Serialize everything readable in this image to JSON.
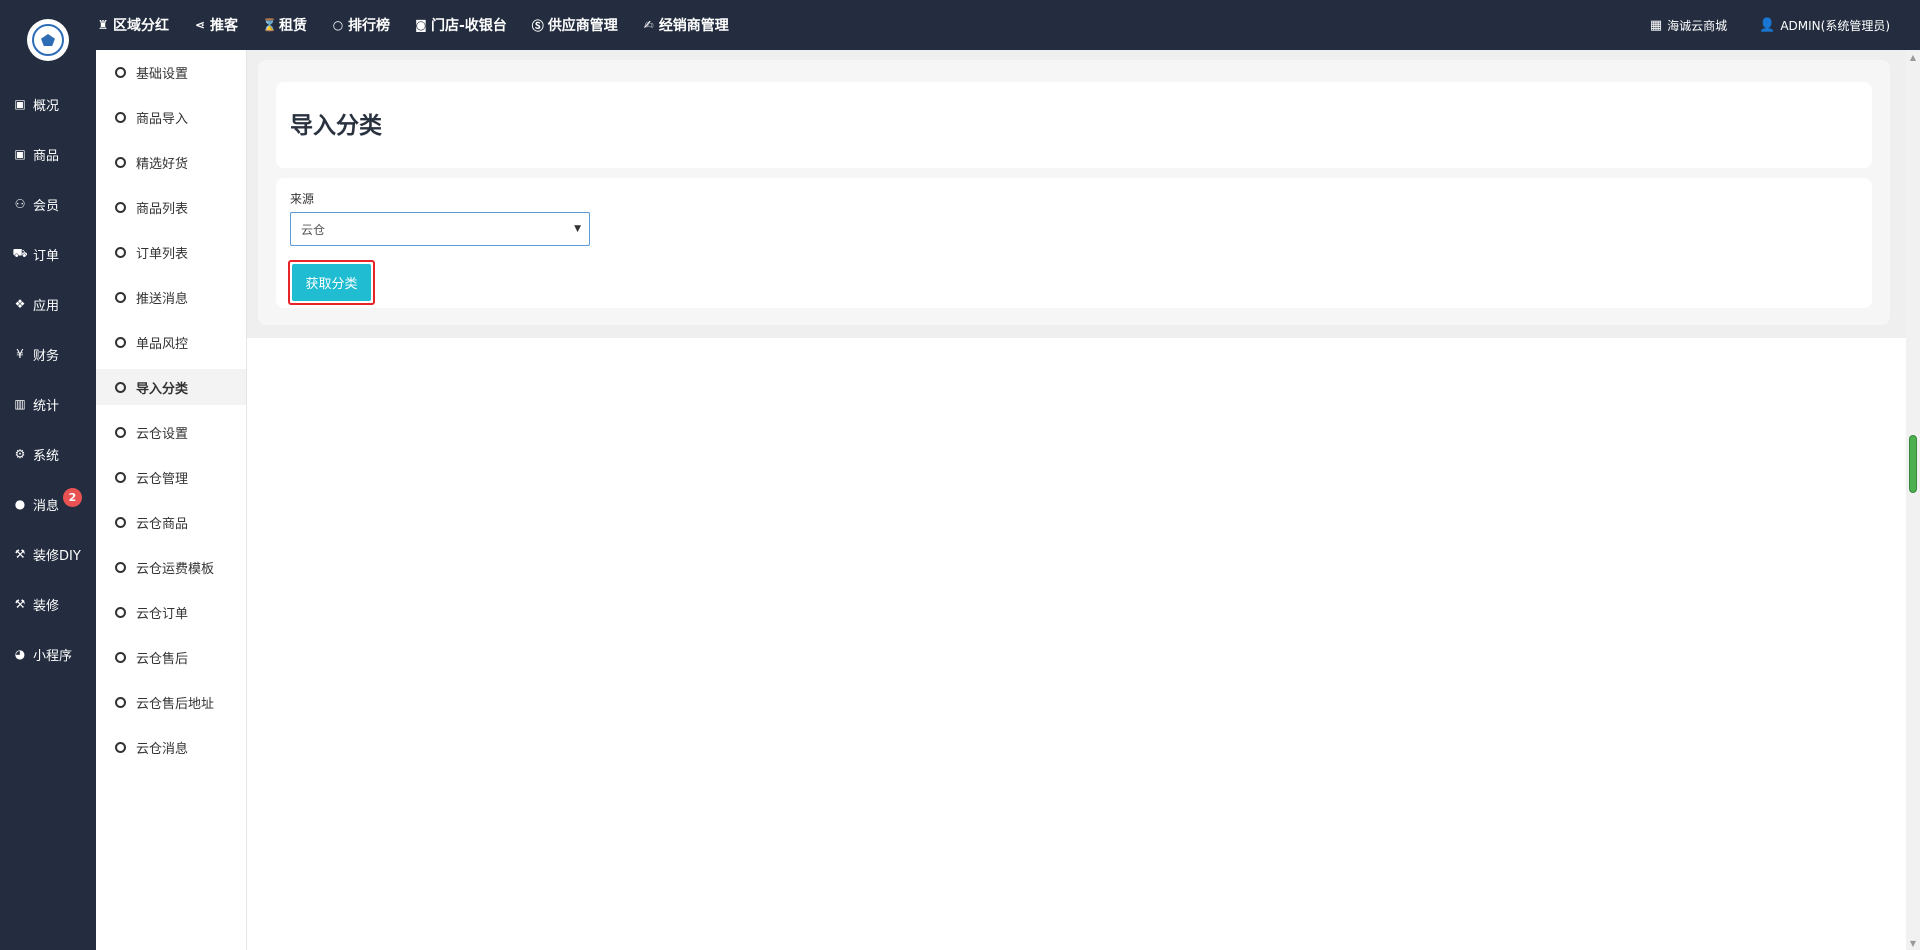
{
  "topnav": [
    {
      "icon": "trophy-icon",
      "glyph": "♜",
      "label": "区域分红"
    },
    {
      "icon": "share-icon",
      "glyph": "⋖",
      "label": "推客"
    },
    {
      "icon": "hourglass-icon",
      "glyph": "⌛",
      "label": "租赁"
    },
    {
      "icon": "circle-icon",
      "glyph": "○",
      "label": "排行榜"
    },
    {
      "icon": "camera-icon",
      "glyph": "◙",
      "label": "门店-收银台"
    },
    {
      "icon": "skype-icon",
      "glyph": "Ⓢ",
      "label": "供应商管理"
    },
    {
      "icon": "pen-icon",
      "glyph": "✍",
      "label": "经销商管理"
    }
  ],
  "topright": {
    "shop_label": "海诚云商城",
    "shop_icon": "grid-icon",
    "user_label": "ADMIN(系统管理员)",
    "user_icon": "user-icon"
  },
  "sidebar": [
    {
      "icon": "box-icon",
      "glyph": "▣",
      "label": "概况"
    },
    {
      "icon": "box-icon",
      "glyph": "▣",
      "label": "商品"
    },
    {
      "icon": "users-icon",
      "glyph": "⚇",
      "label": "会员"
    },
    {
      "icon": "cart-icon",
      "glyph": "⛟",
      "label": "订单"
    },
    {
      "icon": "cubes-icon",
      "glyph": "❖",
      "label": "应用"
    },
    {
      "icon": "yen-icon",
      "glyph": "¥",
      "label": "财务"
    },
    {
      "icon": "bar-chart-icon",
      "glyph": "▥",
      "label": "统计"
    },
    {
      "icon": "gears-icon",
      "glyph": "⚙",
      "label": "系统"
    },
    {
      "icon": "comment-icon",
      "glyph": "●",
      "label": "消息",
      "badge": "2"
    },
    {
      "icon": "gavel-icon",
      "glyph": "⚒",
      "label": "装修DIY"
    },
    {
      "icon": "gavel-icon",
      "glyph": "⚒",
      "label": "装修"
    },
    {
      "icon": "wechat-icon",
      "glyph": "◕",
      "label": "小程序"
    }
  ],
  "submenu": [
    {
      "label": "基础设置",
      "active": false
    },
    {
      "label": "商品导入",
      "active": false
    },
    {
      "label": "精选好货",
      "active": false
    },
    {
      "label": "商品列表",
      "active": false
    },
    {
      "label": "订单列表",
      "active": false
    },
    {
      "label": "推送消息",
      "active": false
    },
    {
      "label": "单品风控",
      "active": false
    },
    {
      "label": "导入分类",
      "active": true
    },
    {
      "label": "云仓设置",
      "active": false
    },
    {
      "label": "云仓管理",
      "active": false
    },
    {
      "label": "云仓商品",
      "active": false
    },
    {
      "label": "云仓运费模板",
      "active": false
    },
    {
      "label": "云仓订单",
      "active": false
    },
    {
      "label": "云仓售后",
      "active": false
    },
    {
      "label": "云仓售后地址",
      "active": false
    },
    {
      "label": "云仓消息",
      "active": false
    }
  ],
  "main": {
    "title": "导入分类",
    "source_label": "来源",
    "source_value": "云仓",
    "fetch_button": "获取分类"
  },
  "colors": {
    "dark_nav": "#232d3f",
    "button": "#1fbcd2",
    "highlight": "#e8242b",
    "badge": "#e85253"
  }
}
